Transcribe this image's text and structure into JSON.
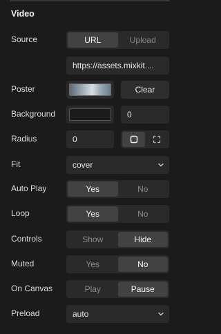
{
  "section": {
    "title": "Video"
  },
  "source": {
    "label": "Source",
    "options": [
      "URL",
      "Upload"
    ],
    "selected": "URL",
    "url_value": "https://assets.mixkit...."
  },
  "poster": {
    "label": "Poster",
    "clear_label": "Clear"
  },
  "background": {
    "label": "Background",
    "value": "0"
  },
  "radius": {
    "label": "Radius",
    "value": "0"
  },
  "fit": {
    "label": "Fit",
    "value": "cover"
  },
  "autoplay": {
    "label": "Auto Play",
    "options": [
      "Yes",
      "No"
    ],
    "selected": "Yes"
  },
  "loop": {
    "label": "Loop",
    "options": [
      "Yes",
      "No"
    ],
    "selected": "Yes"
  },
  "controls": {
    "label": "Controls",
    "options": [
      "Show",
      "Hide"
    ],
    "selected": "Hide"
  },
  "muted": {
    "label": "Muted",
    "options": [
      "Yes",
      "No"
    ],
    "selected": "No"
  },
  "on_canvas": {
    "label": "On Canvas",
    "options": [
      "Play",
      "Pause"
    ],
    "selected": "Pause"
  },
  "preload": {
    "label": "Preload",
    "value": "auto"
  },
  "colors": {
    "panel_bg": "#1b1b1b",
    "control_bg": "#2a2a2a",
    "active_segment": "#424242",
    "inactive_text": "#8a8a8a"
  },
  "icons": {
    "radius_uniform": "square-corners-icon",
    "radius_individual": "individual-corners-icon",
    "select_arrow": "chevron-down-icon"
  }
}
